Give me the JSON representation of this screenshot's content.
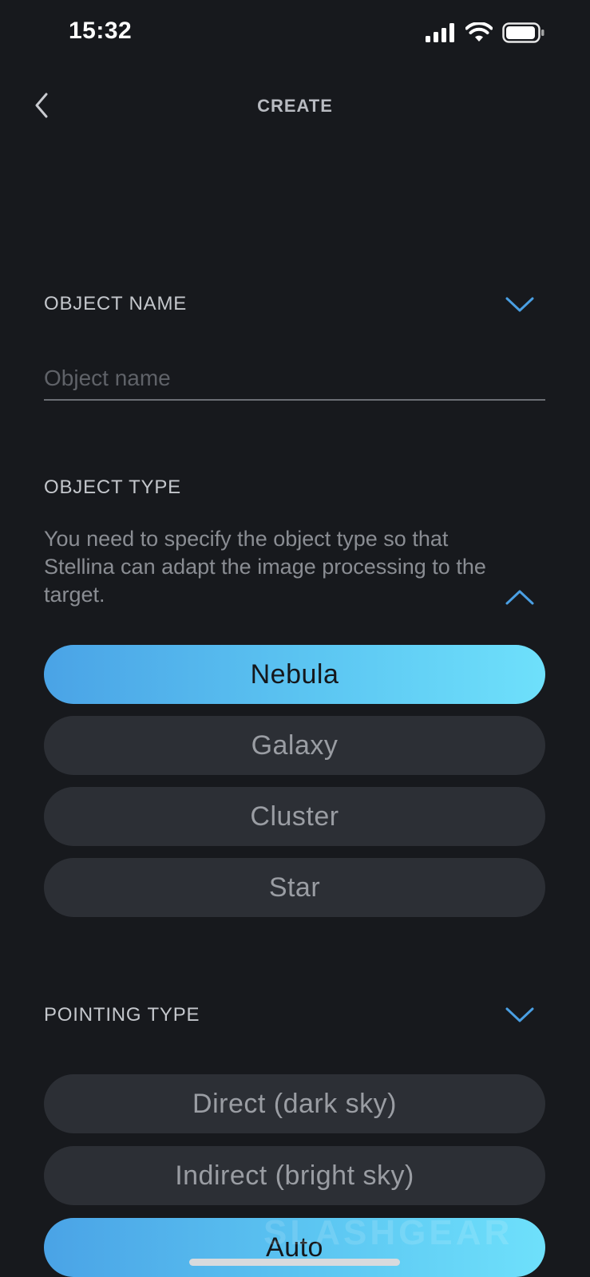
{
  "status_bar": {
    "time": "15:32"
  },
  "header": {
    "title": "CREATE"
  },
  "object_name": {
    "title": "OBJECT NAME",
    "input_value": "",
    "input_placeholder": "Object name"
  },
  "object_type": {
    "title": "OBJECT TYPE",
    "description": "You need to specify the object type so that Stellina can adapt the image processing to the target.",
    "options": [
      "Nebula",
      "Galaxy",
      "Cluster",
      "Star"
    ],
    "selected": "Nebula"
  },
  "pointing_type": {
    "title": "POINTING TYPE",
    "options": [
      "Direct (dark sky)",
      "Indirect (bright sky)",
      "Auto"
    ],
    "selected": "Auto"
  },
  "watermark": "SLASHGEAR",
  "colors": {
    "background": "#17191d",
    "accent": "#4a9fe3",
    "selected_gradient_start": "#4aa3e6",
    "selected_gradient_end": "#6ee0fb",
    "pill_unselected": "#2c2f35"
  },
  "icons": [
    "signal-icon",
    "wifi-icon",
    "battery-icon",
    "back-chevron-icon",
    "chevron-down-icon",
    "chevron-up-icon"
  ]
}
